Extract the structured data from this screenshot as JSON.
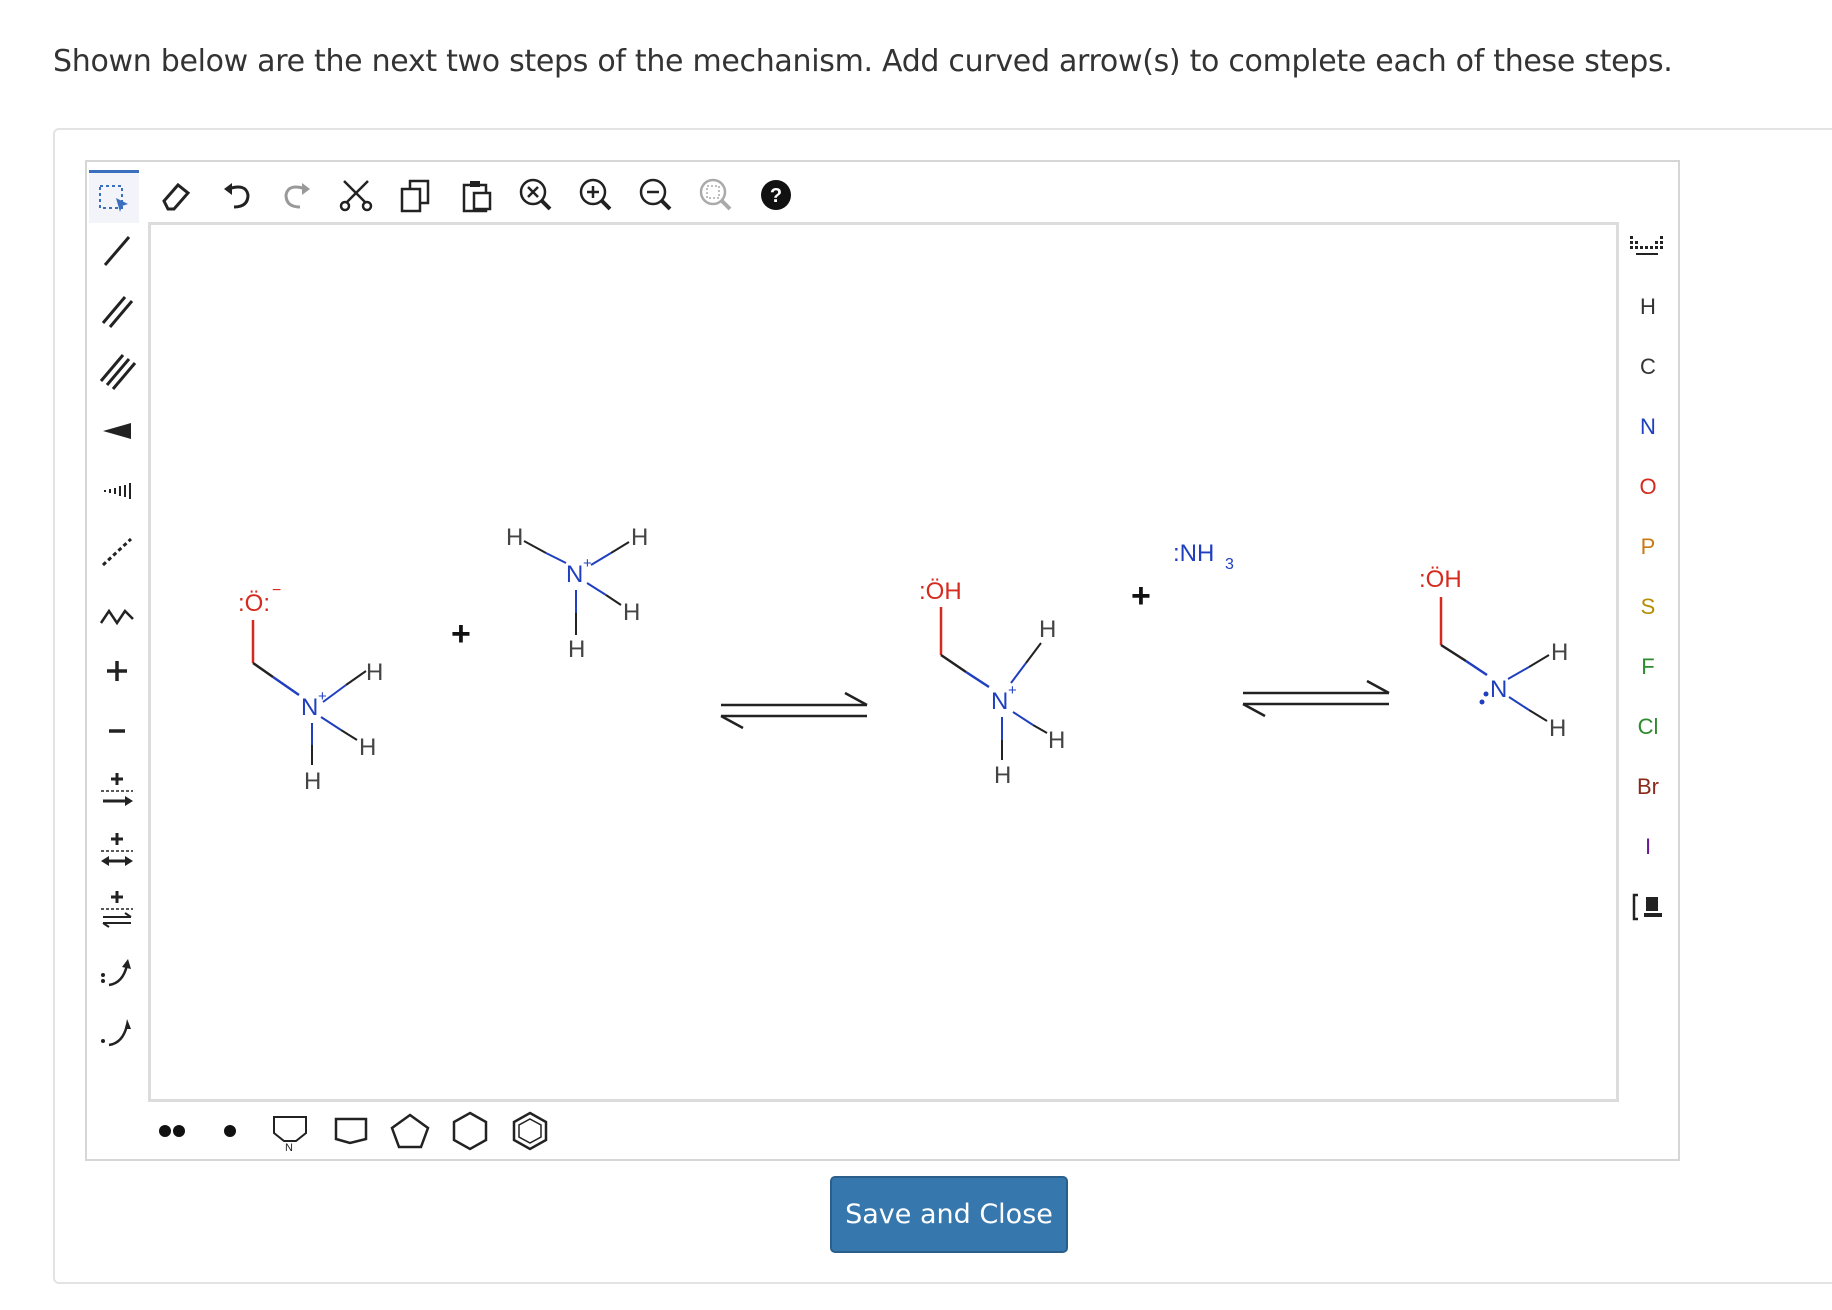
{
  "instruction": "Shown below are the next two steps of the mechanism. Add curved arrow(s) to complete each of these steps.",
  "toolbar_top": {
    "items": [
      "select-icon",
      "eraser-icon",
      "undo-icon",
      "redo-icon",
      "cut-icon",
      "copy-icon",
      "paste-icon",
      "clear-icon",
      "zoom-in-icon",
      "zoom-out-icon",
      "zoom-fit-icon",
      "help-icon"
    ]
  },
  "toolbar_left": {
    "items": [
      "single-bond-icon",
      "double-bond-icon",
      "triple-bond-icon",
      "wedge-bond-icon",
      "hash-bond-icon",
      "dashed-bond-icon",
      "chain-icon",
      "positive-charge-icon",
      "negative-charge-icon",
      "reaction-arrow-icon",
      "resonance-arrow-icon",
      "equilibrium-arrow-icon",
      "electron-pair-arrow-icon",
      "single-electron-arrow-icon"
    ]
  },
  "toolbar_right": {
    "elements": [
      {
        "symbol": "H",
        "color": "#333333"
      },
      {
        "symbol": "C",
        "color": "#333333"
      },
      {
        "symbol": "N",
        "color": "#1f3fbf"
      },
      {
        "symbol": "O",
        "color": "#d62a1e"
      },
      {
        "symbol": "P",
        "color": "#c87a14"
      },
      {
        "symbol": "S",
        "color": "#b58d00"
      },
      {
        "symbol": "F",
        "color": "#2e8b2e"
      },
      {
        "symbol": "Cl",
        "color": "#2e8b2e"
      },
      {
        "symbol": "Br",
        "color": "#8a2a1a"
      },
      {
        "symbol": "I",
        "color": "#6a1b9a"
      }
    ]
  },
  "toolbar_bottom": {
    "items": [
      "lone-pair-icon",
      "radical-icon",
      "pyrrole-icon",
      "cyclobutane-icon",
      "cyclopentane-icon",
      "cyclohexane-icon",
      "benzene-icon"
    ]
  },
  "canvas": {
    "mol1": {
      "o_label": ":Ö:",
      "charge": "−",
      "n_label": "N",
      "n_charge": "+",
      "h": "H"
    },
    "mol2": {
      "n_label": "N",
      "n_charge": "+",
      "h": "H"
    },
    "mol3": {
      "oh_label": ":ÖH",
      "n_label": "N",
      "n_charge": "+",
      "h": "H"
    },
    "mol4": {
      "nh3_label": ":NH",
      "sub": "3"
    },
    "mol5": {
      "oh_label": ":ÖH",
      "n_label": "N",
      "h": "H"
    },
    "plus": "+"
  },
  "save_button": "Save and Close"
}
